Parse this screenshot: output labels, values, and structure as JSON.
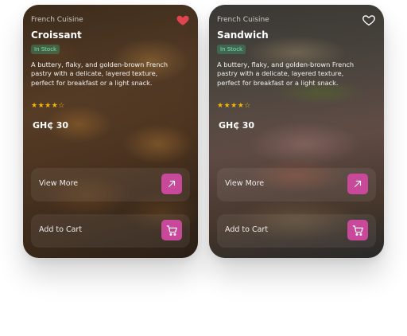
{
  "cards": [
    {
      "cuisine": "French Cuisine",
      "title": "Croissant",
      "badge": "In Stock",
      "description": "A buttery, flaky, and golden-brown French pastry with a delicate, layered texture, perfect for breakfast or a light snack.",
      "rating": "★★★★☆",
      "price": "GH₵ 30",
      "view_more_label": "View More",
      "add_to_cart_label": "Add to Cart",
      "favorited": true
    },
    {
      "cuisine": "French Cuisine",
      "title": "Sandwich",
      "badge": "In Stock",
      "description": "A buttery, flaky, and golden-brown French pastry with a delicate, layered texture, perfect for breakfast or a light snack.",
      "rating": "★★★★☆",
      "price": "GH₵ 30",
      "view_more_label": "View More",
      "add_to_cart_label": "Add to Cart",
      "favorited": false
    }
  ],
  "colors": {
    "accent": "#c8489a",
    "favorite": "#e0454f",
    "stars": "#f2b705",
    "badge_text": "#7fe0b0"
  },
  "icons": {
    "favorite": "heart-icon",
    "view_more": "arrow-up-right-icon",
    "cart": "shopping-cart-icon",
    "rating": "star-icon"
  }
}
